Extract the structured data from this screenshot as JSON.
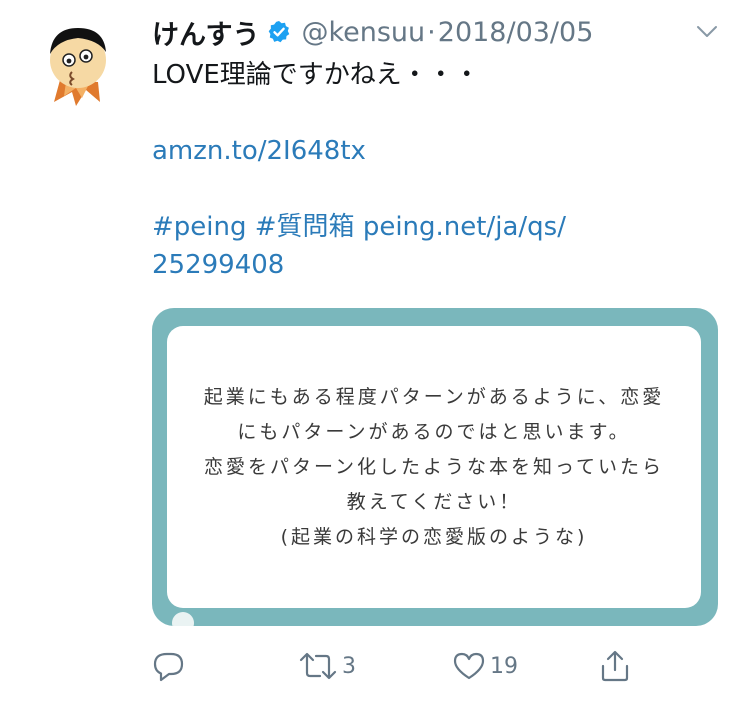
{
  "tweet": {
    "author_name": "けんすう",
    "handle": "@kensuu",
    "separator": "·",
    "date": "2018/03/05",
    "text_line1": "LOVE理論ですかねえ・・・",
    "short_link": "amzn.to/2I648tx",
    "hashtag1": "#peing",
    "hashtag2": "#質問箱",
    "link_part1": "peing.net/ja/qs/",
    "link_part2": "25299408"
  },
  "card": {
    "lines": [
      "起業にもある程度パターンがあるように、恋愛",
      "にもパターンがあるのではと思います。",
      "恋愛をパターン化したような本を知っていたら",
      "教えてください！",
      "(起業の科学の恋愛版のような)"
    ],
    "background_color": "#7ab7bc"
  },
  "actions": {
    "reply_icon": "reply-icon",
    "retweet_icon": "retweet-icon",
    "retweet_count": "3",
    "like_icon": "heart-icon",
    "like_count": "19",
    "share_icon": "share-icon"
  },
  "colors": {
    "link": "#2b7bb9",
    "text": "#14171a",
    "muted": "#657786",
    "verified": "#1da1f2"
  }
}
